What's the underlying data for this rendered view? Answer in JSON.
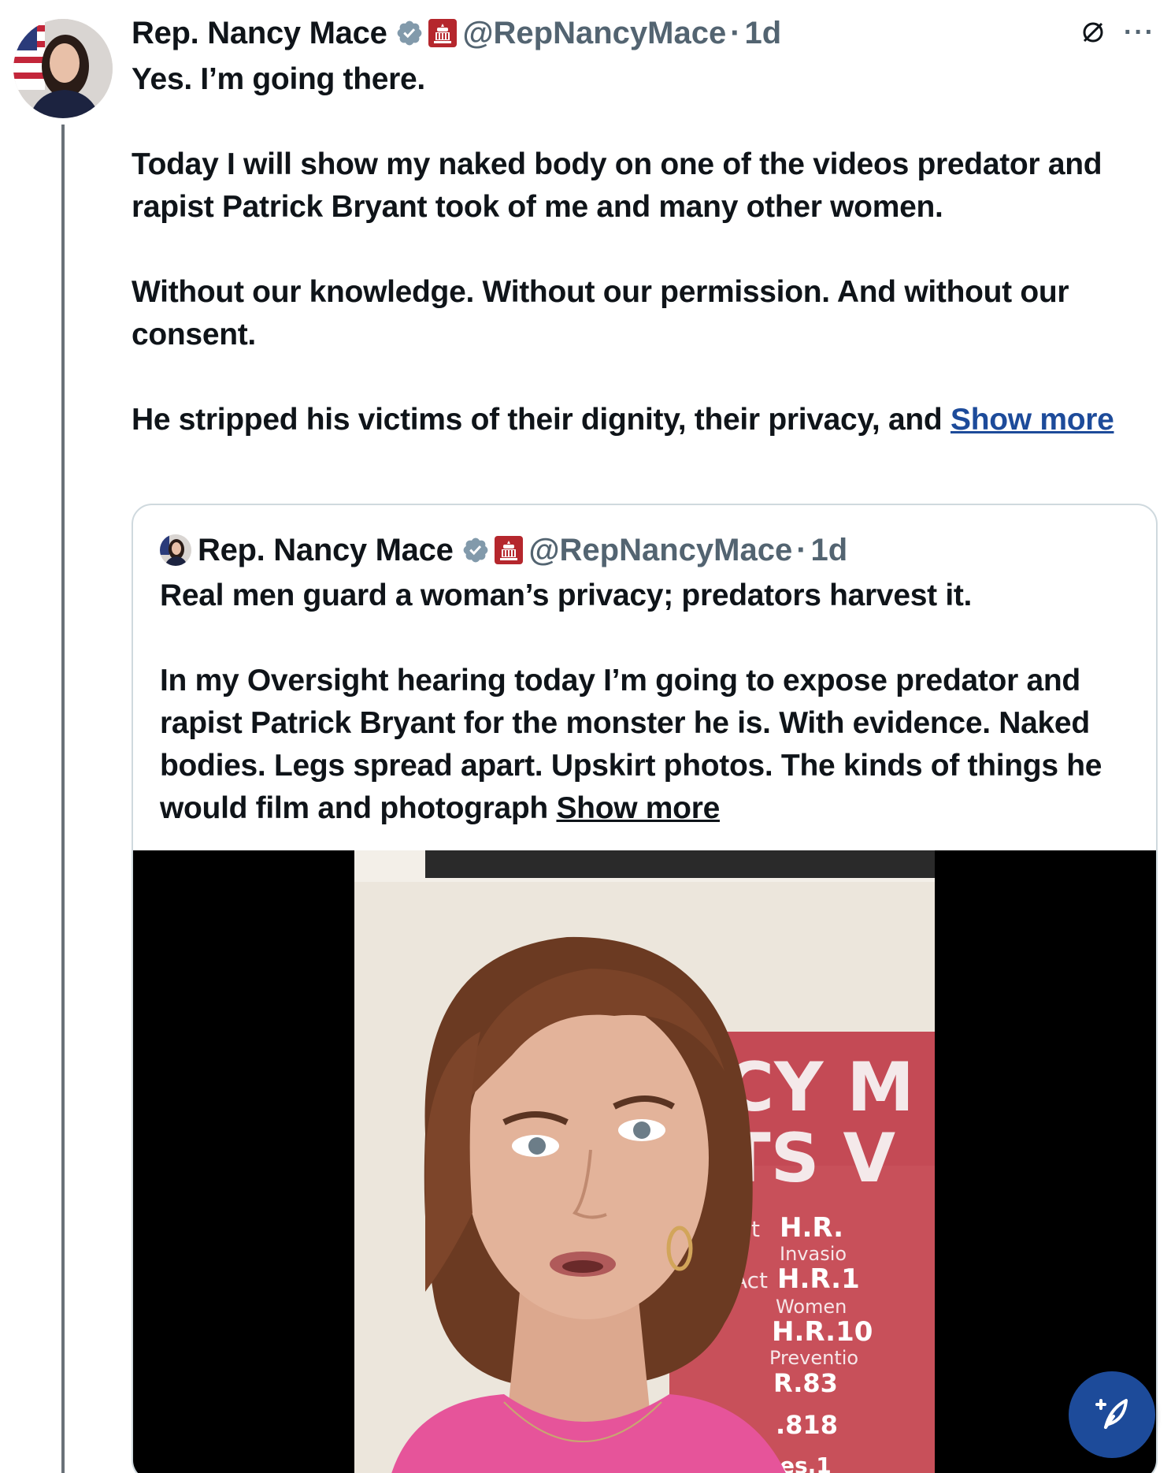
{
  "tweet": {
    "author_name": "Rep. Nancy Mace",
    "handle": "@RepNancyMace",
    "separator": "·",
    "time": "1d",
    "paragraphs": [
      "Yes. I’m going there.",
      "Today I will show my naked body on one of the videos predator and rapist Patrick Bryant took of me and many other women.",
      "Without our knowledge. Without our permission. And without our consent.",
      "He stripped his victims of their dignity, their privacy, and "
    ],
    "show_more": "Show more",
    "icons": {
      "verified": "verified-badge-icon",
      "affiliation": "capitol-affiliation-icon",
      "grok": "grok-icon",
      "more": "more-options-icon"
    }
  },
  "quoted_tweet": {
    "author_name": "Rep. Nancy Mace",
    "handle": "@RepNancyMace",
    "separator": "·",
    "time": "1d",
    "paragraphs": [
      "Real men guard a woman’s privacy; predators harvest it.",
      "In my Oversight hearing today I’m going to expose predator and rapist Patrick Bryant for the monster he is. With evidence. Naked bodies. Legs spread apart. Upskirt photos. The kinds of things he would film and photograph "
    ],
    "show_more": "Show more"
  },
  "media": {
    "sign_text": [
      "CY M",
      "TS V"
    ],
    "bill_lines": [
      "Act",
      "H.R.",
      "Invasio",
      "Act",
      "H.R.1",
      "Women",
      "H.R.10",
      "Preventio",
      "R.83",
      ".818",
      "es.1"
    ]
  },
  "compose_button": {
    "icon": "compose-post-icon"
  },
  "colors": {
    "link": "#1d4b9a",
    "secondary_text": "#536471",
    "verified_badge": "#829aab",
    "affiliation_red": "#b5272d",
    "fab_background": "#1d4b9a"
  }
}
